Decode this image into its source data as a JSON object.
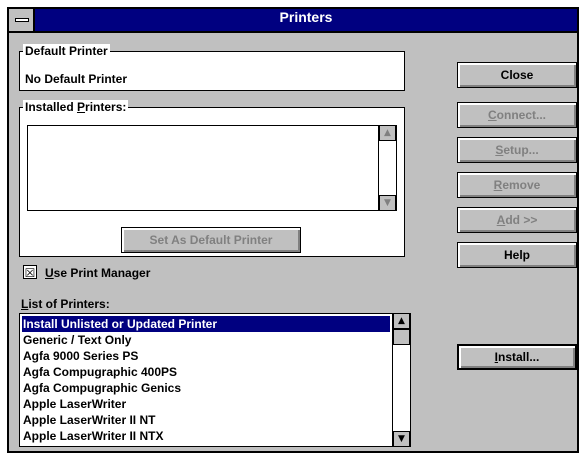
{
  "window": {
    "title": "Printers"
  },
  "default_printer": {
    "label": "Default Printer",
    "value": "No Default Printer"
  },
  "installed": {
    "label_pre": "Installed ",
    "label_key": "P",
    "label_post": "rinters:",
    "items": [],
    "set_default_button": "Set As Default Printer"
  },
  "use_print_manager": {
    "checked": true,
    "mark": "☒",
    "label_key": "U",
    "label_post": "se Print Manager"
  },
  "list_of_printers": {
    "label_key": "L",
    "label_post": "ist of Printers:",
    "items": [
      "Install Unlisted or Updated Printer",
      "Generic / Text Only",
      "Agfa 9000 Series PS",
      "Agfa Compugraphic 400PS",
      "Agfa Compugraphic Genics",
      "Apple LaserWriter",
      "Apple LaserWriter II NT",
      "Apple LaserWriter II NTX"
    ],
    "selected_index": 0
  },
  "buttons": {
    "close": "Close",
    "connect": "Connect...",
    "setup": "Setup...",
    "remove": "Remove",
    "add": "Add >>",
    "help": "Help",
    "install": "Install..."
  },
  "colors": {
    "title_bar": "#000080",
    "face": "#c0c0c0",
    "disabled_text": "#808080",
    "selection": "#000080"
  }
}
